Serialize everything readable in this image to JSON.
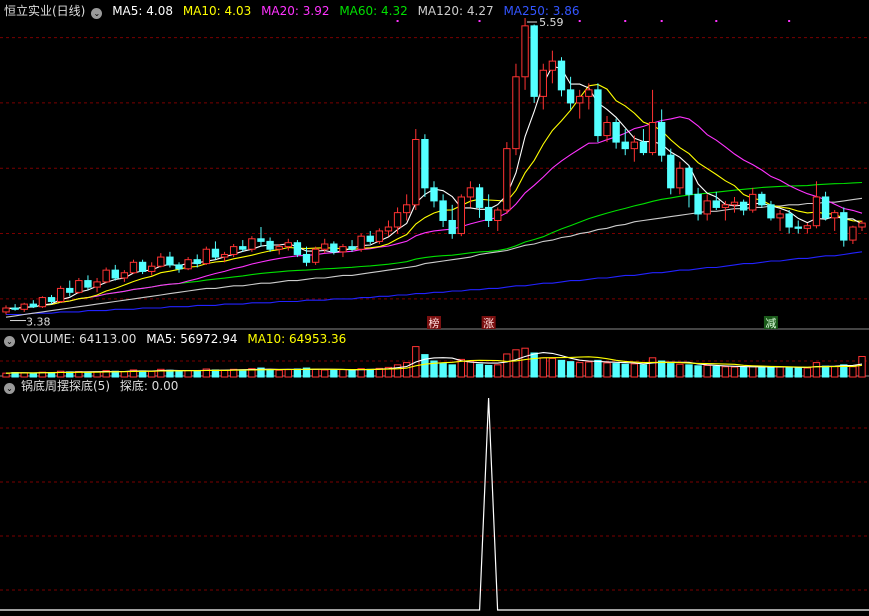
{
  "main_header": {
    "title": "恒立实业(日线)",
    "ma5": "MA5: 4.08",
    "ma10": "MA10: 4.03",
    "ma20": "MA20: 3.92",
    "ma60": "MA60: 4.32",
    "ma120": "MA120: 4.27",
    "ma250": "MA250: 3.86"
  },
  "volume_header": {
    "volume": "VOLUME: 64113.00",
    "ma5": "MA5: 56972.94",
    "ma10": "MA10: 64953.36"
  },
  "indicator_header": {
    "name": "锅底周摆探底(5)",
    "value": "探底: 0.00"
  },
  "colors": {
    "up": "#ff3333",
    "down": "#54ffff",
    "ma5": "#ffffff",
    "ma10": "#ffff00",
    "ma20": "#ff33ff",
    "ma60": "#00e000",
    "ma120": "#cccccc",
    "ma250": "#2222ff",
    "grid": "#7a0000"
  },
  "chart_data": [
    {
      "type": "candlestick",
      "name": "price",
      "y_range": [
        3.3,
        5.65
      ],
      "high_label": "5.59",
      "low_label": "3.38",
      "markers": [
        "榜",
        "涨",
        "减"
      ],
      "ohlc": [
        [
          3.4,
          3.45,
          3.38,
          3.43
        ],
        [
          3.43,
          3.46,
          3.41,
          3.42
        ],
        [
          3.42,
          3.47,
          3.4,
          3.46
        ],
        [
          3.46,
          3.49,
          3.43,
          3.44
        ],
        [
          3.44,
          3.52,
          3.43,
          3.51
        ],
        [
          3.51,
          3.53,
          3.46,
          3.48
        ],
        [
          3.48,
          3.6,
          3.47,
          3.58
        ],
        [
          3.58,
          3.64,
          3.52,
          3.55
        ],
        [
          3.55,
          3.66,
          3.54,
          3.64
        ],
        [
          3.64,
          3.68,
          3.57,
          3.59
        ],
        [
          3.59,
          3.66,
          3.55,
          3.63
        ],
        [
          3.63,
          3.74,
          3.62,
          3.72
        ],
        [
          3.72,
          3.76,
          3.64,
          3.66
        ],
        [
          3.66,
          3.72,
          3.63,
          3.7
        ],
        [
          3.7,
          3.8,
          3.69,
          3.78
        ],
        [
          3.78,
          3.8,
          3.69,
          3.71
        ],
        [
          3.71,
          3.78,
          3.68,
          3.75
        ],
        [
          3.75,
          3.85,
          3.74,
          3.82
        ],
        [
          3.82,
          3.86,
          3.74,
          3.76
        ],
        [
          3.76,
          3.78,
          3.7,
          3.73
        ],
        [
          3.73,
          3.82,
          3.72,
          3.8
        ],
        [
          3.8,
          3.84,
          3.74,
          3.77
        ],
        [
          3.77,
          3.9,
          3.76,
          3.88
        ],
        [
          3.88,
          3.94,
          3.8,
          3.82
        ],
        [
          3.82,
          3.86,
          3.78,
          3.84
        ],
        [
          3.84,
          3.92,
          3.82,
          3.9
        ],
        [
          3.9,
          3.95,
          3.86,
          3.88
        ],
        [
          3.88,
          3.98,
          3.86,
          3.96
        ],
        [
          3.96,
          4.05,
          3.9,
          3.94
        ],
        [
          3.94,
          3.97,
          3.86,
          3.88
        ],
        [
          3.88,
          3.92,
          3.84,
          3.9
        ],
        [
          3.9,
          3.96,
          3.87,
          3.93
        ],
        [
          3.93,
          3.95,
          3.82,
          3.84
        ],
        [
          3.84,
          3.9,
          3.75,
          3.78
        ],
        [
          3.78,
          3.9,
          3.76,
          3.88
        ],
        [
          3.88,
          3.96,
          3.85,
          3.92
        ],
        [
          3.92,
          3.94,
          3.84,
          3.86
        ],
        [
          3.86,
          3.92,
          3.82,
          3.9
        ],
        [
          3.9,
          3.95,
          3.86,
          3.88
        ],
        [
          3.88,
          4.0,
          3.86,
          3.98
        ],
        [
          3.98,
          4.02,
          3.92,
          3.94
        ],
        [
          3.94,
          4.04,
          3.92,
          4.02
        ],
        [
          4.02,
          4.1,
          3.98,
          4.05
        ],
        [
          4.05,
          4.2,
          4.0,
          4.16
        ],
        [
          4.16,
          4.3,
          4.1,
          4.22
        ],
        [
          4.22,
          4.8,
          4.18,
          4.72
        ],
        [
          4.72,
          4.76,
          4.28,
          4.35
        ],
        [
          4.35,
          4.4,
          4.2,
          4.25
        ],
        [
          4.25,
          4.3,
          4.05,
          4.1
        ],
        [
          4.1,
          4.22,
          3.96,
          4.0
        ],
        [
          4.0,
          4.3,
          3.98,
          4.28
        ],
        [
          4.28,
          4.4,
          4.2,
          4.35
        ],
        [
          4.35,
          4.38,
          4.12,
          4.2
        ],
        [
          4.2,
          4.3,
          4.05,
          4.1
        ],
        [
          4.1,
          4.2,
          4.02,
          4.18
        ],
        [
          4.18,
          4.7,
          4.15,
          4.65
        ],
        [
          4.65,
          5.3,
          4.6,
          5.2
        ],
        [
          5.2,
          5.65,
          5.1,
          5.59
        ],
        [
          5.59,
          5.6,
          5.0,
          5.05
        ],
        [
          5.05,
          5.3,
          4.95,
          5.25
        ],
        [
          5.25,
          5.4,
          5.15,
          5.32
        ],
        [
          5.32,
          5.35,
          5.05,
          5.1
        ],
        [
          5.1,
          5.2,
          4.95,
          5.0
        ],
        [
          5.0,
          5.1,
          4.88,
          5.05
        ],
        [
          5.05,
          5.15,
          4.95,
          5.1
        ],
        [
          5.1,
          5.15,
          4.7,
          4.75
        ],
        [
          4.75,
          4.9,
          4.7,
          4.85
        ],
        [
          4.85,
          4.88,
          4.65,
          4.7
        ],
        [
          4.7,
          4.8,
          4.6,
          4.65
        ],
        [
          4.65,
          4.75,
          4.55,
          4.7
        ],
        [
          4.7,
          4.8,
          4.6,
          4.62
        ],
        [
          4.62,
          5.1,
          4.6,
          4.85
        ],
        [
          4.85,
          4.95,
          4.55,
          4.6
        ],
        [
          4.6,
          4.65,
          4.3,
          4.35
        ],
        [
          4.35,
          4.55,
          4.3,
          4.5
        ],
        [
          4.5,
          4.52,
          4.2,
          4.3
        ],
        [
          4.3,
          4.35,
          4.1,
          4.15
        ],
        [
          4.15,
          4.3,
          4.1,
          4.25
        ],
        [
          4.25,
          4.32,
          4.18,
          4.2
        ],
        [
          4.2,
          4.25,
          4.1,
          4.22
        ],
        [
          4.22,
          4.28,
          4.16,
          4.24
        ],
        [
          4.24,
          4.26,
          4.14,
          4.18
        ],
        [
          4.18,
          4.35,
          4.16,
          4.3
        ],
        [
          4.3,
          4.32,
          4.2,
          4.22
        ],
        [
          4.22,
          4.25,
          4.1,
          4.12
        ],
        [
          4.12,
          4.18,
          4.02,
          4.15
        ],
        [
          4.15,
          4.18,
          4.0,
          4.05
        ],
        [
          4.05,
          4.1,
          4.0,
          4.04
        ],
        [
          4.04,
          4.08,
          4.0,
          4.06
        ],
        [
          4.06,
          4.4,
          4.04,
          4.28
        ],
        [
          4.28,
          4.32,
          4.1,
          4.12
        ],
        [
          4.12,
          4.18,
          4.02,
          4.16
        ],
        [
          4.16,
          4.2,
          3.9,
          3.95
        ],
        [
          3.95,
          4.06,
          3.92,
          4.05
        ],
        [
          4.05,
          4.1,
          4.02,
          4.08
        ]
      ],
      "ma120": [
        3.36,
        3.37,
        3.38,
        3.39,
        3.4,
        3.41,
        3.42,
        3.43,
        3.44,
        3.45,
        3.46,
        3.47,
        3.48,
        3.49,
        3.5,
        3.51,
        3.52,
        3.53,
        3.54,
        3.55,
        3.56,
        3.57,
        3.58,
        3.58,
        3.59,
        3.6,
        3.6,
        3.61,
        3.62,
        3.62,
        3.63,
        3.64,
        3.64,
        3.65,
        3.66,
        3.66,
        3.67,
        3.68,
        3.68,
        3.69,
        3.7,
        3.71,
        3.72,
        3.73,
        3.74,
        3.75,
        3.77,
        3.78,
        3.79,
        3.8,
        3.81,
        3.82,
        3.84,
        3.85,
        3.86,
        3.87,
        3.89,
        3.91,
        3.92,
        3.94,
        3.95,
        3.97,
        3.98,
        4.0,
        4.01,
        4.03,
        4.04,
        4.06,
        4.07,
        4.09,
        4.1,
        4.11,
        4.12,
        4.13,
        4.14,
        4.15,
        4.16,
        4.17,
        4.17,
        4.18,
        4.19,
        4.19,
        4.2,
        4.2,
        4.21,
        4.21,
        4.22,
        4.22,
        4.23,
        4.23,
        4.24,
        4.24,
        4.25,
        4.26,
        4.27
      ],
      "ma250": [
        3.38,
        3.38,
        3.38,
        3.39,
        3.39,
        3.39,
        3.4,
        3.4,
        3.4,
        3.41,
        3.41,
        3.41,
        3.42,
        3.42,
        3.42,
        3.43,
        3.43,
        3.43,
        3.44,
        3.44,
        3.44,
        3.45,
        3.45,
        3.45,
        3.46,
        3.46,
        3.46,
        3.47,
        3.47,
        3.47,
        3.48,
        3.48,
        3.48,
        3.49,
        3.49,
        3.49,
        3.5,
        3.5,
        3.5,
        3.51,
        3.51,
        3.52,
        3.52,
        3.53,
        3.53,
        3.54,
        3.54,
        3.55,
        3.55,
        3.56,
        3.56,
        3.57,
        3.57,
        3.58,
        3.58,
        3.59,
        3.6,
        3.6,
        3.61,
        3.62,
        3.62,
        3.63,
        3.64,
        3.64,
        3.65,
        3.66,
        3.66,
        3.67,
        3.68,
        3.68,
        3.69,
        3.7,
        3.7,
        3.71,
        3.72,
        3.72,
        3.73,
        3.74,
        3.74,
        3.75,
        3.76,
        3.77,
        3.77,
        3.78,
        3.79,
        3.79,
        3.8,
        3.81,
        3.81,
        3.82,
        3.83,
        3.83,
        3.84,
        3.85,
        3.86
      ]
    },
    {
      "type": "bar",
      "name": "volume",
      "y_range": [
        0,
        100000
      ],
      "values": [
        12000,
        14000,
        13000,
        12500,
        15000,
        14000,
        18000,
        16000,
        17000,
        15500,
        16000,
        20000,
        18000,
        17000,
        22000,
        19000,
        18000,
        24000,
        21000,
        18000,
        20000,
        19000,
        25000,
        22000,
        21000,
        24000,
        22000,
        26000,
        28000,
        22000,
        21000,
        23000,
        25000,
        28000,
        24000,
        22000,
        21000,
        23000,
        22000,
        26000,
        24000,
        27000,
        30000,
        38000,
        45000,
        95000,
        70000,
        50000,
        42000,
        38000,
        55000,
        48000,
        40000,
        36000,
        38000,
        72000,
        85000,
        90000,
        75000,
        60000,
        58000,
        52000,
        48000,
        45000,
        47000,
        52000,
        44000,
        42000,
        40000,
        41000,
        38000,
        60000,
        50000,
        42000,
        40000,
        38000,
        35000,
        36000,
        33000,
        32000,
        31000,
        30000,
        34000,
        32000,
        30000,
        31000,
        30000,
        29000,
        28000,
        45000,
        34000,
        33000,
        38000,
        32000,
        64113
      ]
    },
    {
      "type": "line",
      "name": "探底",
      "y_range": [
        0,
        1
      ],
      "spike_index": 53,
      "spike_value": 1
    }
  ]
}
